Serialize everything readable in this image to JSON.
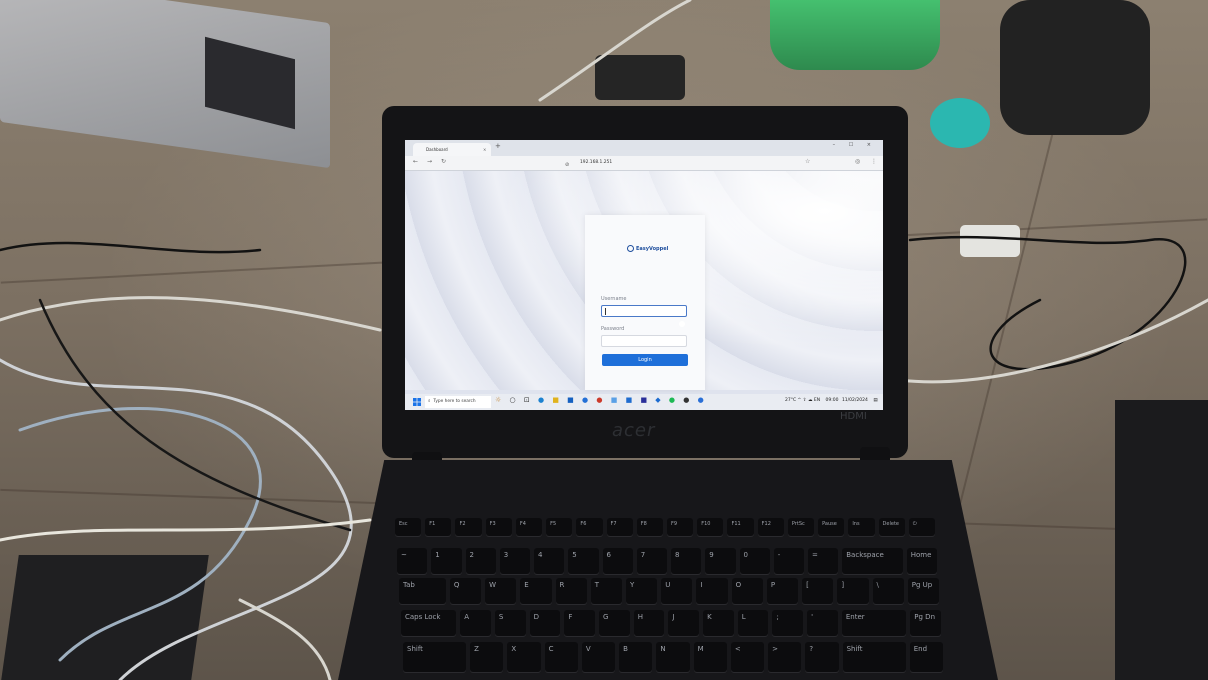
{
  "browser": {
    "tab_title": "Dashboard",
    "tab_close": "×",
    "new_tab": "+",
    "url": "192.168.1.251",
    "window_controls": "– ☐ ×"
  },
  "login": {
    "logo_text": "EasyVoppel",
    "username_label": "Username",
    "password_label": "Password",
    "login_button": "Login"
  },
  "taskbar": {
    "search_placeholder": "Type here to search",
    "tray_text": "27°C  ^ ⇧ ☁ EN",
    "time": "09:00",
    "date": "11/02/2024"
  },
  "laptop": {
    "brand": "acer",
    "badge": "HDMI"
  },
  "keyboard_rows": [
    [
      "Esc",
      "F1",
      "F2",
      "F3",
      "F4",
      "F5",
      "F6",
      "F7",
      "F8",
      "F9",
      "F10",
      "F11",
      "F12",
      "PrtSc",
      "Pause",
      "Ins",
      "Delete",
      "⏻"
    ],
    [
      "~",
      "1",
      "2",
      "3",
      "4",
      "5",
      "6",
      "7",
      "8",
      "9",
      "0",
      "-",
      "=",
      "Backspace",
      "Home"
    ],
    [
      "Tab",
      "Q",
      "W",
      "E",
      "R",
      "T",
      "Y",
      "U",
      "I",
      "O",
      "P",
      "[",
      "]",
      "\\",
      "Pg Up"
    ],
    [
      "Caps Lock",
      "A",
      "S",
      "D",
      "F",
      "G",
      "H",
      "J",
      "K",
      "L",
      ";",
      "'",
      "Enter",
      "Pg Dn"
    ],
    [
      "Shift",
      "Z",
      "X",
      "C",
      "V",
      "B",
      "N",
      "M",
      "<",
      ">",
      "?",
      "Shift",
      "End"
    ]
  ],
  "colors": {
    "accent": "#1e6fd9",
    "screen_bg": "#dfe3ee",
    "lid": "#141416"
  }
}
